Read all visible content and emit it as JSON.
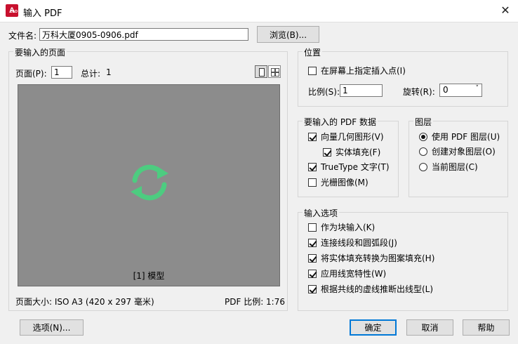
{
  "window": {
    "title": "输入 PDF",
    "close_glyph": "✕"
  },
  "file": {
    "label": "文件名:",
    "value": "万科大厦0905-0906.pdf",
    "browse": "浏览(B)..."
  },
  "pages": {
    "group_title": "要输入的页面",
    "page_label": "页面(P):",
    "page_value": "1",
    "total_label": "总计:",
    "total_value": "1",
    "preview_caption": "[1] 模型",
    "page_size": "页面大小: ISO A3 (420 x 297 毫米)",
    "pdf_scale": "PDF 比例: 1:76"
  },
  "position": {
    "group_title": "位置",
    "specify_on_screen": {
      "label": "在屏幕上指定插入点(I)",
      "checked": false
    },
    "scale_label": "比例(S):",
    "scale_value": "1",
    "rotation_label": "旋转(R):",
    "rotation_value": "0"
  },
  "pdf_data": {
    "group_title": "要输入的 PDF 数据",
    "items": [
      {
        "label": "向量几何图形(V)",
        "checked": true
      },
      {
        "label": "实体填充(F)",
        "checked": true
      },
      {
        "label": "TrueType 文字(T)",
        "checked": true
      },
      {
        "label": "光栅图像(M)",
        "checked": false
      }
    ]
  },
  "layers": {
    "group_title": "图层",
    "options": [
      {
        "label": "使用 PDF 图层(U)",
        "checked": true
      },
      {
        "label": "创建对象图层(O)",
        "checked": false
      },
      {
        "label": "当前图层(C)",
        "checked": false
      }
    ]
  },
  "import_options": {
    "group_title": "输入选项",
    "items": [
      {
        "label": "作为块输入(K)",
        "checked": false
      },
      {
        "label": "连接线段和圆弧段(J)",
        "checked": true
      },
      {
        "label": "将实体填充转换为图案填充(H)",
        "checked": true
      },
      {
        "label": "应用线宽特性(W)",
        "checked": true
      },
      {
        "label": "根据共线的虚线推断出线型(L)",
        "checked": true
      }
    ]
  },
  "buttons": {
    "options": "选项(N)...",
    "ok": "确定",
    "cancel": "取消",
    "help": "帮助"
  },
  "colors": {
    "accent": "#0078d7",
    "refresh_icon": "#4dcc80",
    "preview_bg": "#8c8c8c"
  }
}
